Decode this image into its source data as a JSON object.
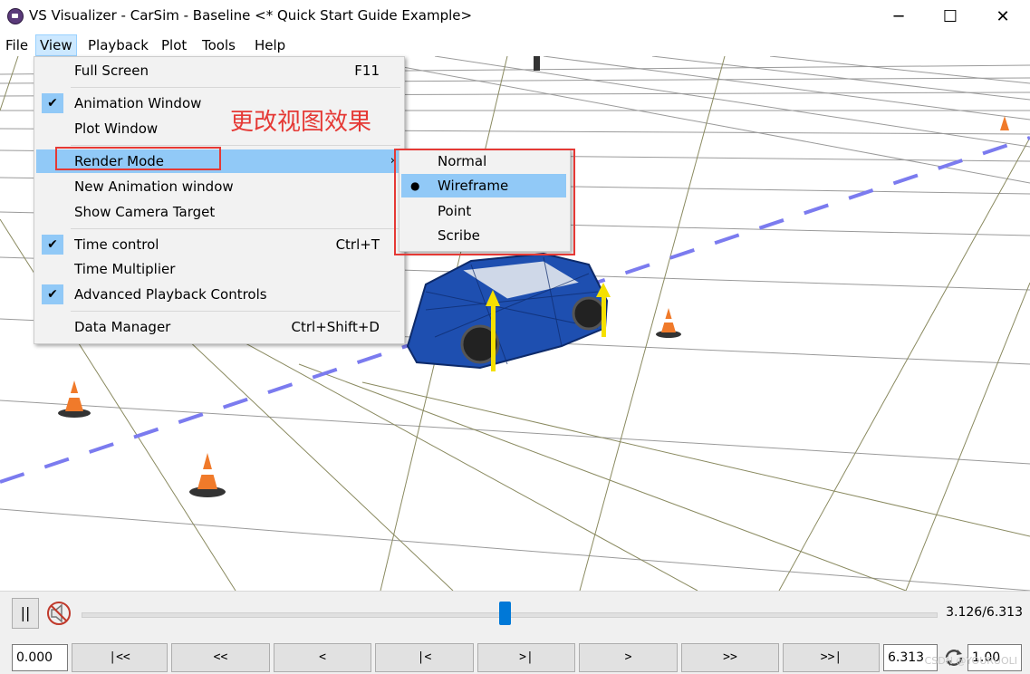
{
  "window": {
    "title": "VS Visualizer - CarSim - Baseline <* Quick Start Guide Example>",
    "minimize": "─",
    "maximize": "☐",
    "close": "✕"
  },
  "menubar": [
    "File",
    "View",
    "Playback",
    "Plot",
    "Tools",
    "Help"
  ],
  "view_menu": {
    "full_screen": {
      "label": "Full Screen",
      "shortcut": "F11"
    },
    "animation_window": {
      "label": "Animation Window",
      "checked": true
    },
    "plot_window": {
      "label": "Plot Window"
    },
    "render_mode": {
      "label": "Render Mode",
      "arrow": "›"
    },
    "new_animation_window": {
      "label": "New Animation window"
    },
    "show_camera_target": {
      "label": "Show Camera Target"
    },
    "time_control": {
      "label": "Time control",
      "shortcut": "Ctrl+T",
      "checked": true
    },
    "time_multiplier": {
      "label": "Time Multiplier"
    },
    "advanced_playback": {
      "label": "Advanced Playback Controls",
      "checked": true
    },
    "data_manager": {
      "label": "Data Manager",
      "shortcut": "Ctrl+Shift+D"
    }
  },
  "render_mode_submenu": {
    "items": [
      "Normal",
      "Wireframe",
      "Point",
      "Scribe"
    ],
    "selected": "Wireframe"
  },
  "annotation": "更改视图效果",
  "check_mark": "✔",
  "bullet": "●",
  "playback": {
    "pause_label": "||",
    "progress": 0.495,
    "time_readout": "3.126/6.313",
    "start_time": "0.000",
    "end_time": "6.313",
    "speed": "1.00",
    "nav_buttons": [
      "|<<",
      "<<",
      "<",
      "|<",
      ">|",
      ">",
      ">>",
      ">>|"
    ]
  },
  "watermark": "CSDN @YOURUOLI",
  "colors": {
    "menu_highlight": "#91c9f7",
    "annotation_red": "#e53935",
    "car_blue": "#1e4fb0",
    "lane_dash": "#7b7bef",
    "slider_thumb": "#0078d7"
  }
}
